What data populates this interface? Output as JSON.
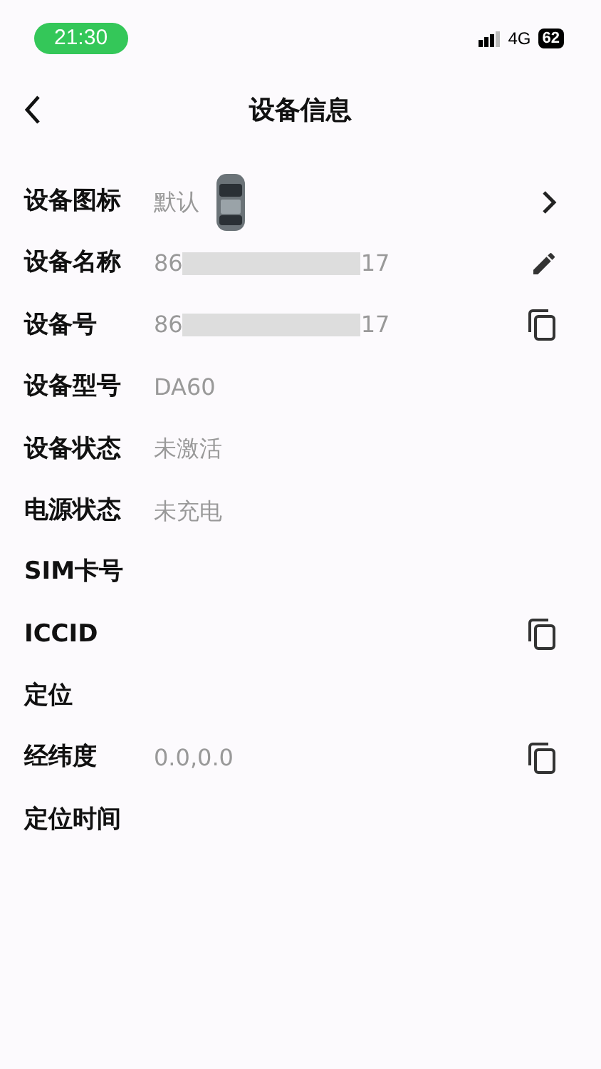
{
  "status_bar": {
    "time": "21:30",
    "network": "4G",
    "battery": "62"
  },
  "nav": {
    "title": "设备信息"
  },
  "rows": [
    {
      "label": "设备图标",
      "value": "默认",
      "car_icon": true,
      "kind": "chevron"
    },
    {
      "label": "设备名称",
      "value_start": "86",
      "redacted": true,
      "value_end": "17",
      "kind": "edit"
    },
    {
      "label": "设备号",
      "value_start": "86",
      "redacted": true,
      "value_end": "17",
      "kind": "copy"
    },
    {
      "label": "设备型号",
      "value": "DA60"
    },
    {
      "label": "设备状态",
      "value": "未激活"
    },
    {
      "label": "电源状态",
      "value": "未充电"
    },
    {
      "label": "SIM卡号"
    },
    {
      "label": "ICCID",
      "kind": "copy"
    },
    {
      "label": "定位"
    },
    {
      "label": "经纬度",
      "value": "0.0,0.0",
      "kind": "copy"
    },
    {
      "label": "定位时间"
    }
  ]
}
